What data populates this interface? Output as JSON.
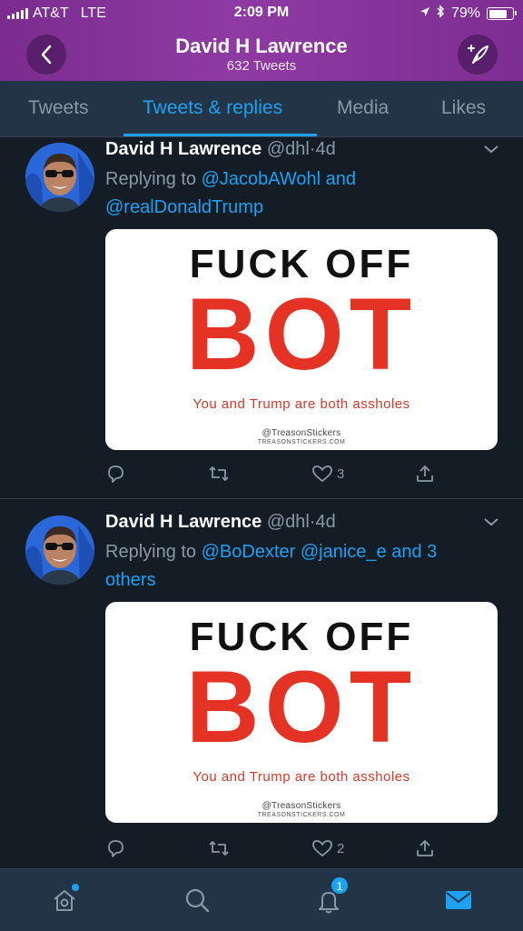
{
  "status_bar": {
    "carrier": "AT&T",
    "network": "LTE",
    "time": "2:09 PM",
    "battery": "79%"
  },
  "header": {
    "title": "David H Lawrence",
    "subtitle": "632 Tweets",
    "back_icon": "chevron-left-icon",
    "compose_icon": "compose-tweet-icon"
  },
  "tabs": [
    {
      "label": "Tweets",
      "active": false
    },
    {
      "label": "Tweets & replies",
      "active": true
    },
    {
      "label": "Media",
      "active": false
    },
    {
      "label": "Likes",
      "active": false
    }
  ],
  "tweets": [
    {
      "name": "David H Lawrence",
      "handle": "@dhl",
      "separator": "·",
      "time": "4d",
      "replying_prefix": "Replying to",
      "mention_1": "@JacobAWohl",
      "joiner": "and",
      "mention_2": "@realDonaldTrump",
      "media": {
        "line1": "FUCK OFF",
        "line2": "BOT",
        "line3": "You and Trump are both assholes",
        "line4": "@TreasonStickers",
        "line5": "TREASONSTICKERS.COM"
      },
      "likes": "3"
    },
    {
      "name": "David H Lawrence",
      "handle": "@dhl",
      "separator": "·",
      "time": "4d",
      "replying_prefix": "Replying to",
      "mention_1": "@BoDexter",
      "mention_2": "@janice_e",
      "joiner": "and",
      "others": "3 others",
      "media": {
        "line1": "FUCK OFF",
        "line2": "BOT",
        "line3": "You and Trump are both assholes",
        "line4": "@TreasonStickers",
        "line5": "TREASONSTICKERS.COM"
      },
      "likes": "2"
    }
  ],
  "bottom_nav": {
    "items": [
      "home-icon",
      "search-icon",
      "notifications-icon",
      "messages-icon"
    ],
    "notification_count": "1"
  },
  "colors": {
    "accent": "#1da1f2",
    "header_purple": "#8f3aa3",
    "background": "#141d26",
    "sticker_red": "#e43325"
  }
}
